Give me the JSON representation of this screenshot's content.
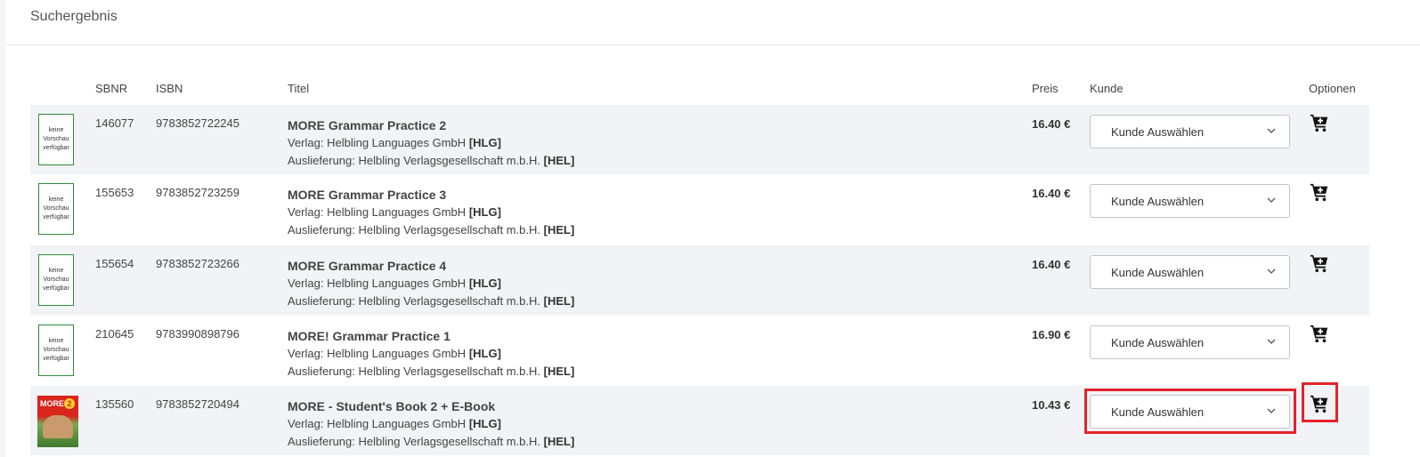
{
  "section": {
    "title": "Suchergebnis"
  },
  "table": {
    "headers": {
      "sbnr": "SBNR",
      "isbn": "ISBN",
      "titel": "Titel",
      "preis": "Preis",
      "kunde": "Kunde",
      "optionen": "Optionen"
    },
    "rows": [
      {
        "thumb": "keine Vorschau verfügbar",
        "thumb_lines": [
          "keine",
          "Vorschau",
          "verfügbar"
        ],
        "sbnr": "146077",
        "isbn": "9783852722245",
        "title": "MORE Grammar Practice 2",
        "verlag_prefix": "Verlag: Helbling Languages GmbH",
        "verlag_code": "[HLG]",
        "auslieferung_prefix": "Auslieferung: Helbling Verlagsgesellschaft m.b.H.",
        "auslieferung_code": "[HEL]",
        "price": "16.40 €",
        "kunde": "Kunde Auswählen",
        "cart_icon": "add-to-cart-icon"
      },
      {
        "thumb": "keine Vorschau verfügbar",
        "thumb_lines": [
          "keine",
          "Vorschau",
          "verfügbar"
        ],
        "sbnr": "155653",
        "isbn": "9783852723259",
        "title": "MORE Grammar Practice 3",
        "verlag_prefix": "Verlag: Helbling Languages GmbH",
        "verlag_code": "[HLG]",
        "auslieferung_prefix": "Auslieferung: Helbling Verlagsgesellschaft m.b.H.",
        "auslieferung_code": "[HEL]",
        "price": "16.40 €",
        "kunde": "Kunde Auswählen",
        "cart_icon": "add-to-cart-icon"
      },
      {
        "thumb": "keine Vorschau verfügbar",
        "thumb_lines": [
          "keine",
          "Vorschau",
          "verfügbar"
        ],
        "sbnr": "155654",
        "isbn": "9783852723266",
        "title": "MORE Grammar Practice 4",
        "verlag_prefix": "Verlag: Helbling Languages GmbH",
        "verlag_code": "[HLG]",
        "auslieferung_prefix": "Auslieferung: Helbling Verlagsgesellschaft m.b.H.",
        "auslieferung_code": "[HEL]",
        "price": "16.40 €",
        "kunde": "Kunde Auswählen",
        "cart_icon": "add-to-cart-icon"
      },
      {
        "thumb": "keine Vorschau verfügbar",
        "thumb_lines": [
          "keine",
          "Vorschau",
          "verfügbar"
        ],
        "sbnr": "210645",
        "isbn": "9783990898796",
        "title": "MORE! Grammar Practice 1",
        "verlag_prefix": "Verlag: Helbling Languages GmbH",
        "verlag_code": "[HLG]",
        "auslieferung_prefix": "Auslieferung: Helbling Verlagsgesellschaft m.b.H.",
        "auslieferung_code": "[HEL]",
        "price": "16.90 €",
        "kunde": "Kunde Auswählen",
        "cart_icon": "add-to-cart-icon"
      },
      {
        "thumb": "cover image",
        "cover_title": "MORE!",
        "cover_number": "2",
        "sbnr": "135560",
        "isbn": "9783852720494",
        "title": "MORE - Student's Book 2 + E-Book",
        "verlag_prefix": "Verlag: Helbling Languages GmbH",
        "verlag_code": "[HLG]",
        "auslieferung_prefix": "Auslieferung: Helbling Verlagsgesellschaft m.b.H.",
        "auslieferung_code": "[HEL]",
        "price": "10.43 €",
        "kunde": "Kunde Auswählen",
        "cart_icon": "add-to-cart-icon",
        "highlighted": true
      }
    ]
  },
  "colors": {
    "row_alt_bg": "#f2f3f6",
    "thumb_border": "#2e8b3a",
    "highlight": "#e3232c"
  }
}
